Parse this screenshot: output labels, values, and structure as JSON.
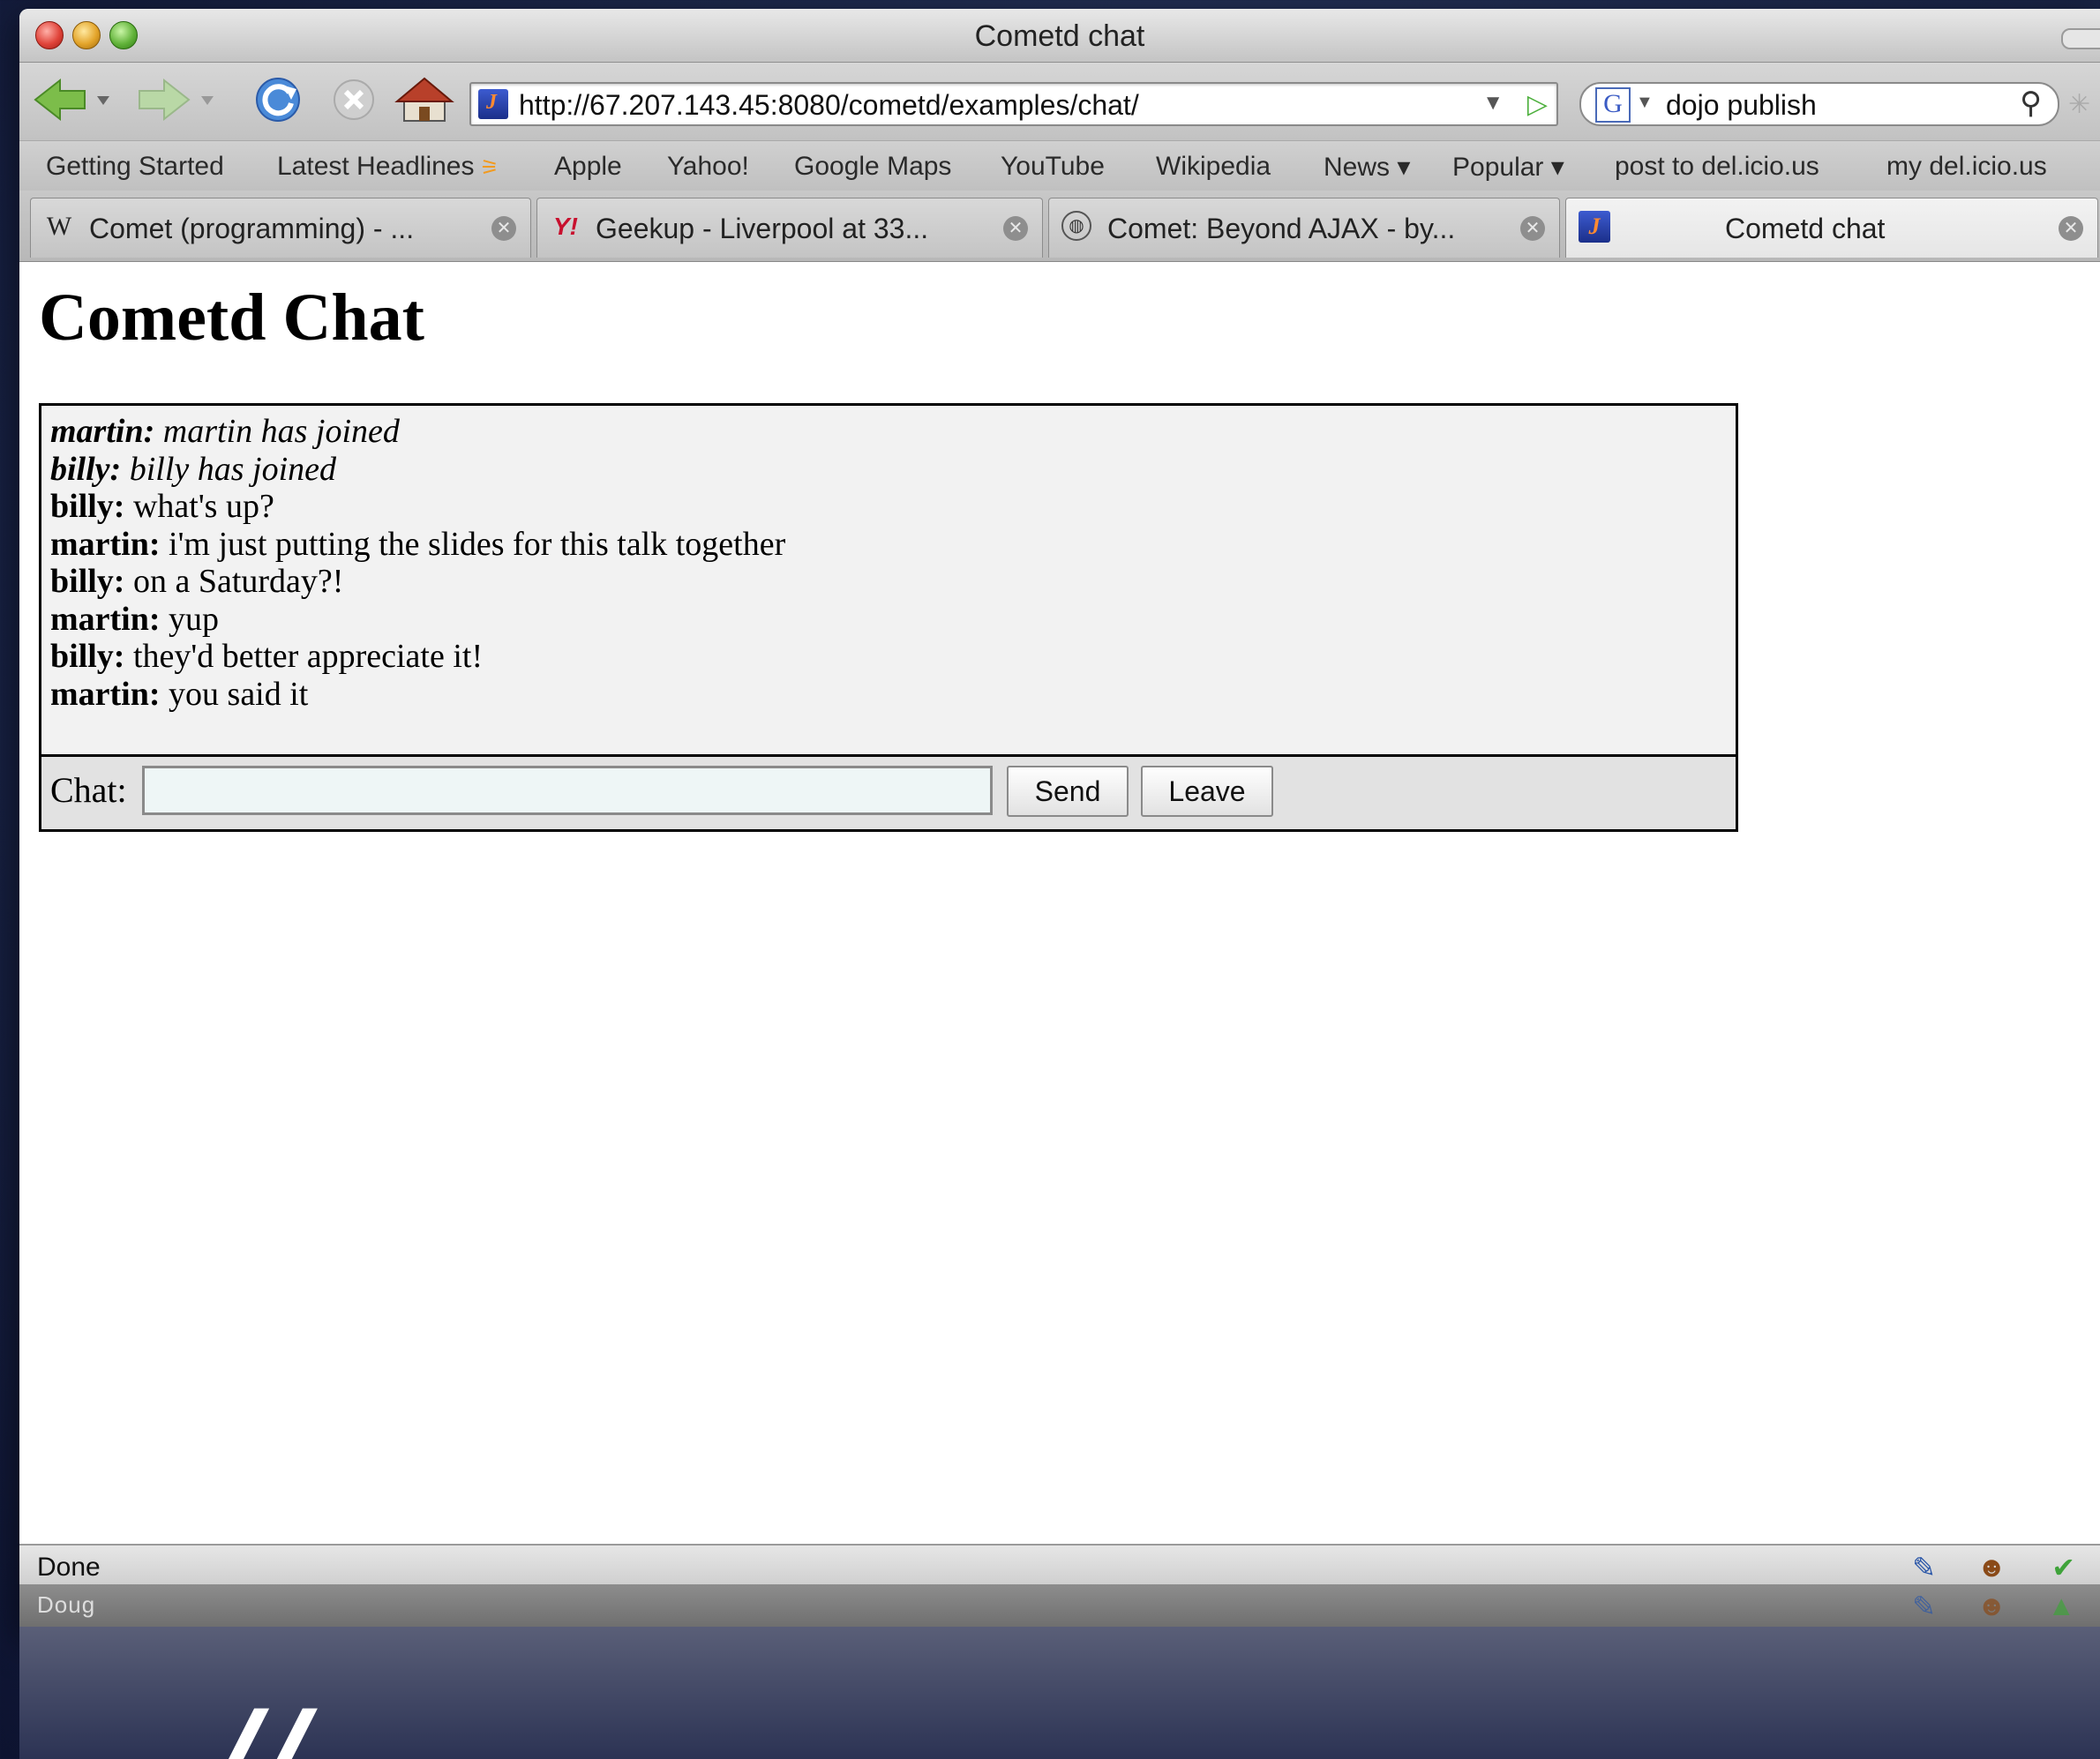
{
  "window": {
    "title": "Cometd chat"
  },
  "nav": {
    "url": "http://67.207.143.45:8080/cometd/examples/chat/",
    "search_value": "dojo publish"
  },
  "bookmarks": [
    "Getting Started",
    "Latest Headlines",
    "Apple",
    "Yahoo!",
    "Google Maps",
    "YouTube",
    "Wikipedia",
    "News ▾",
    "Popular ▾",
    "post to del.icio.us",
    "my del.icio.us"
  ],
  "tabs": [
    {
      "label": "Comet (programming) - ..."
    },
    {
      "label": "Geekup - Liverpool at 33..."
    },
    {
      "label": "Comet: Beyond AJAX - by..."
    },
    {
      "label": "Cometd chat"
    }
  ],
  "page": {
    "heading": "Cometd Chat",
    "messages": [
      {
        "user": "martin:",
        "text": " martin has joined"
      },
      {
        "user": "billy:",
        "text": " billy has joined"
      },
      {
        "user": "billy:",
        "text": " what's up?"
      },
      {
        "user": "martin:",
        "text": " i'm just putting the slides for this talk together"
      },
      {
        "user": "billy:",
        "text": " on a Saturday?!"
      },
      {
        "user": "martin:",
        "text": " yup"
      },
      {
        "user": "billy:",
        "text": " they'd better appreciate it!"
      },
      {
        "user": "martin:",
        "text": " you said it"
      }
    ],
    "chat_label": "Chat:",
    "chat_value": "",
    "send_label": "Send",
    "leave_label": "Leave"
  },
  "status": {
    "text": "Done",
    "addon_text": "Doug"
  },
  "slide": {
    "text": "// "
  },
  "colors": {
    "desktop": "#1e2a4e",
    "chat_bg": "#f2f2f2",
    "input_bg": "#eef6f6"
  }
}
